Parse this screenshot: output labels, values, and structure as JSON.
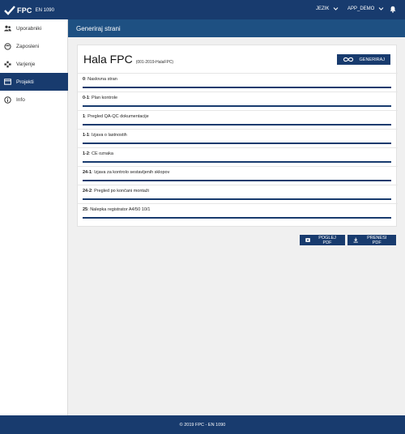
{
  "topbar": {
    "logo_main": "FPC",
    "logo_sub": "EN 1090",
    "language_label": "JEZIK",
    "user_label": "APP_DEMO",
    "icons": [
      "fpc-logo-icon",
      "chevron-down-icon",
      "bell-icon"
    ]
  },
  "sidebar": {
    "items": [
      {
        "label": "Uporabniki",
        "icon": "users-icon"
      },
      {
        "label": "Zaposleni",
        "icon": "employee-icon"
      },
      {
        "label": "Varjenje",
        "icon": "welding-icon"
      },
      {
        "label": "Projekti",
        "icon": "projects-icon",
        "active": true
      },
      {
        "label": "Info",
        "icon": "info-icon"
      }
    ]
  },
  "page_header": {
    "title": "Generiraj strani"
  },
  "card": {
    "title": "Hala FPC",
    "code": "(001-2019-HalaFPC)",
    "generate_label": "GENERIRAJ",
    "rows": [
      {
        "num": "0",
        "text": "Naslovna stran",
        "progress": 1
      },
      {
        "num": "0-1",
        "text": "Plan kontrole",
        "progress": 1
      },
      {
        "num": "1",
        "text": "Pregled QA-QC dokumentacije",
        "progress": 1
      },
      {
        "num": "1-1",
        "text": "Izjava o lastnostih",
        "progress": 1
      },
      {
        "num": "1-2",
        "text": "CE oznaka",
        "progress": 1
      },
      {
        "num": "24-1",
        "text": "Izjava za kontrolo sestavljenih sklopov",
        "progress": 1
      },
      {
        "num": "24-2",
        "text": "Pregled po končani montaži",
        "progress": 1
      },
      {
        "num": "25",
        "text": "Nalepka registrator A4/50 10/1",
        "progress": 1
      }
    ]
  },
  "actions": {
    "view_pdf_label": "POGLEJ PDF",
    "download_pdf_label": "PRENESI PDF"
  },
  "footer": {
    "text": "© 2019 FPC - EN 1090"
  },
  "colors": {
    "primary": "#183b6e",
    "header": "#1e5082",
    "background": "#f0f0f0"
  }
}
